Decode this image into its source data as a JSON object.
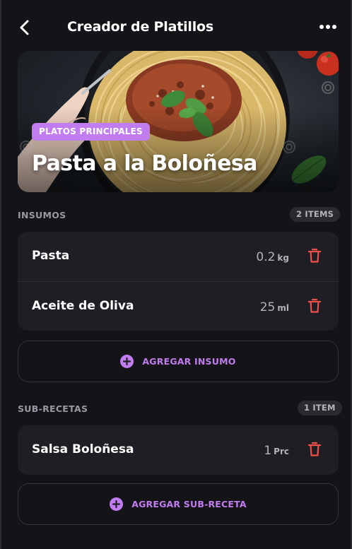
{
  "header": {
    "title": "Creador de Platillos",
    "back_icon": "chevron-left-icon",
    "more_icon": "more-horizontal-icon"
  },
  "hero": {
    "category": "PLATOS PRINCIPALES",
    "dish_name": "Pasta a la Boloñesa"
  },
  "insumos": {
    "label": "INSUMOS",
    "count": "2 ITEMS",
    "items": [
      {
        "name": "Pasta",
        "qty": "0.2",
        "unit": "kg"
      },
      {
        "name": "Aceite de Oliva",
        "qty": "25",
        "unit": "ml"
      }
    ],
    "add_label": "AGREGAR INSUMO"
  },
  "subrecetas": {
    "label": "SUB-RECETAS",
    "count": "1 ITEM",
    "items": [
      {
        "name": "Salsa Boloñesa",
        "qty": "1",
        "unit": "Prc"
      }
    ],
    "add_label": "AGREGAR SUB-RECETA"
  },
  "colors": {
    "background": "#141318",
    "card": "#1f1e24",
    "accent": "#c17cf0",
    "delete": "#f0504a"
  }
}
